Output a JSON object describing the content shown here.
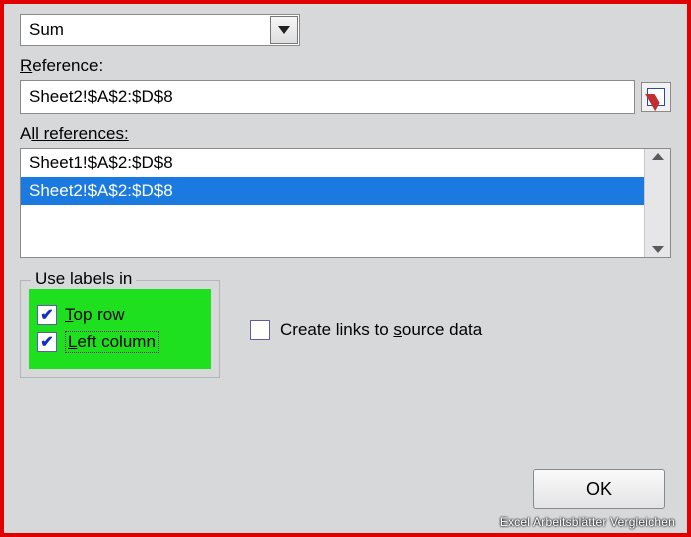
{
  "function_dropdown": {
    "selected": "Sum"
  },
  "labels": {
    "reference_prefix": "R",
    "reference_rest": "eference:",
    "all_refs_prefix": "A",
    "all_refs_rest": "ll references:",
    "use_labels": "Use labels in",
    "top_row_prefix": "T",
    "top_row_rest": "op row",
    "left_col_prefix": "L",
    "left_col_rest": "eft column",
    "create_links_pre": "Create links to ",
    "create_links_u": "s",
    "create_links_post": "ource data",
    "ok": "OK"
  },
  "reference_input": "Sheet2!$A$2:$D$8",
  "all_references": [
    {
      "text": "Sheet1!$A$2:$D$8",
      "selected": false
    },
    {
      "text": "Sheet2!$A$2:$D$8",
      "selected": true
    }
  ],
  "checkboxes": {
    "top_row": true,
    "left_column": true,
    "create_links": false
  },
  "watermark": "Excel Arbeitsblätter Vergleichen"
}
